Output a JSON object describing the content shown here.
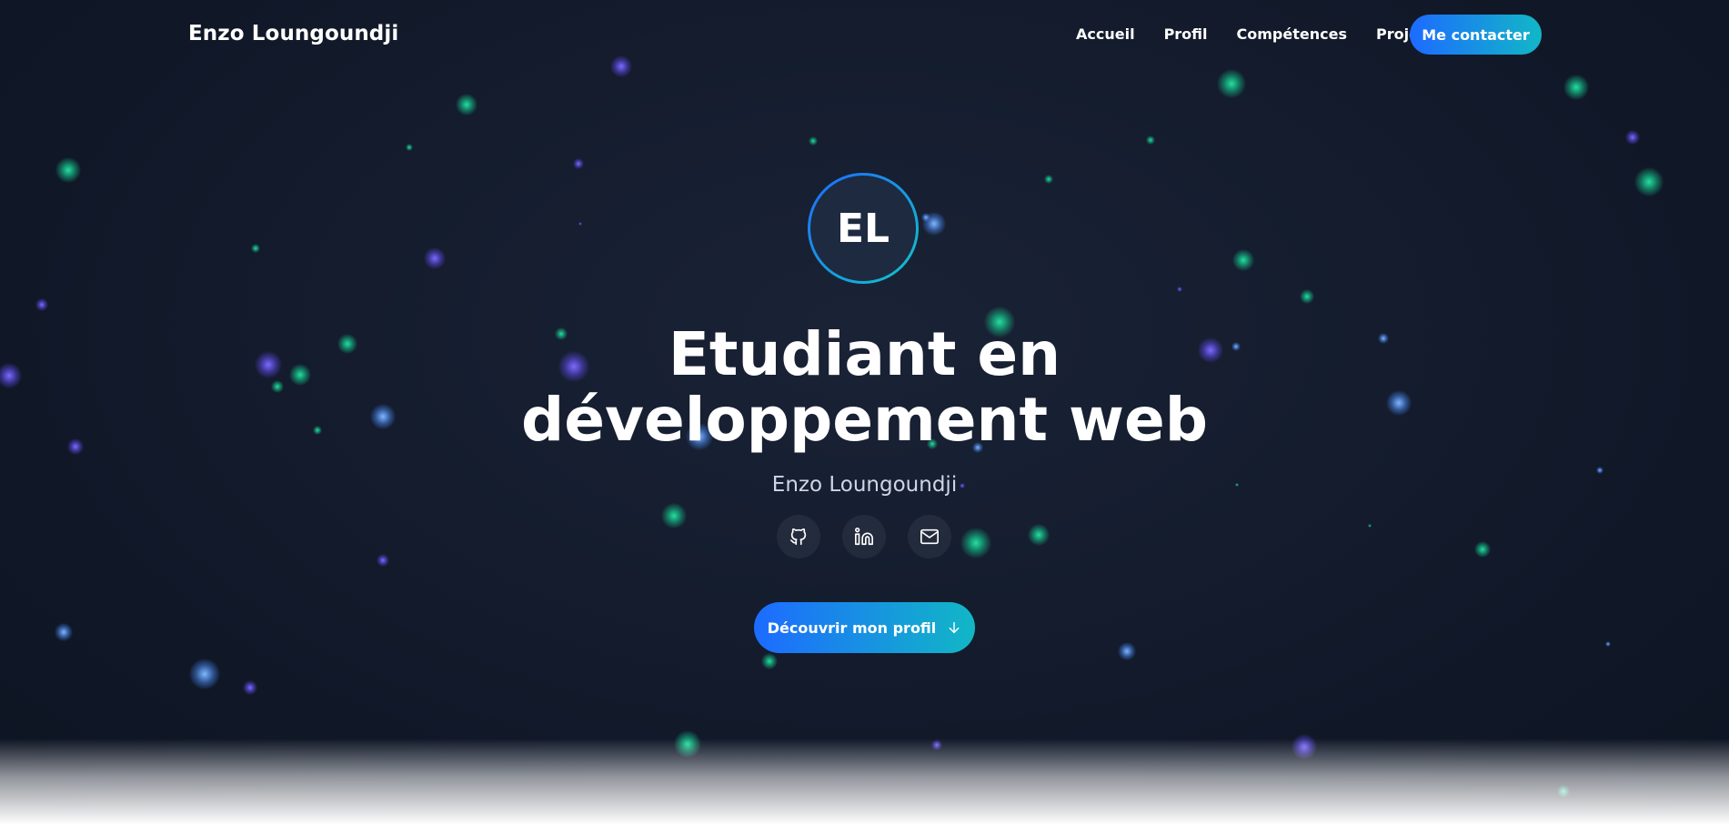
{
  "nav": {
    "brand": "Enzo Loungoundji",
    "links": [
      "Accueil",
      "Profil",
      "Compétences",
      "Projets"
    ],
    "contact_label": "Me contacter"
  },
  "hero": {
    "avatar_initials": "EL",
    "headline_line1": "Etudiant en",
    "headline_line2": "développement web",
    "subtitle": "Enzo Loungoundji",
    "socials": [
      "github-icon",
      "linkedin-icon",
      "mail-icon"
    ],
    "cta_label": "Découvrir mon profil"
  },
  "colors": {
    "accent_start": "#1d6bff",
    "accent_end": "#12b7c6",
    "background": "#121a2b"
  }
}
